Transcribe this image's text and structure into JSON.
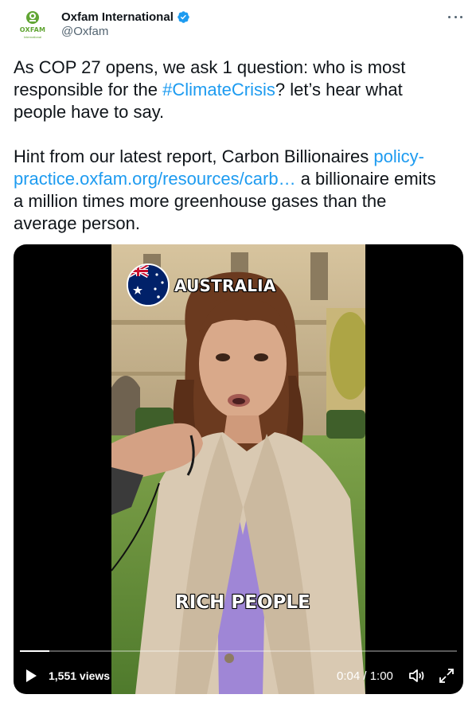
{
  "account": {
    "display_name": "Oxfam International",
    "handle": "@Oxfam",
    "avatar_wordmark": "OXFAM",
    "avatar_subtext": "International",
    "verified": true
  },
  "tweet": {
    "line1": "As COP 27 opens, we ask 1 question: who is most",
    "line2_before": "responsible for the ",
    "hashtag": "#ClimateCrisis",
    "line2_after": "?  let’s hear what",
    "line3": "people have to say.",
    "p2_before": "Hint from our latest report, Carbon Billionaires ",
    "p2_link_a": "policy-",
    "p2_link_b": "practice.oxfam.org/resources/carb…",
    "p2_after_link": " a billionaire emits",
    "p2_line3": "a million times more greenhouse gases than the",
    "p2_line4": "average person."
  },
  "video": {
    "caption_top": "AUSTRALIA",
    "caption_bottom": "RICH PEOPLE",
    "views": "1,551 views",
    "time": "0:04 / 1:00",
    "progress": 0.067
  },
  "colors": {
    "link": "#1d9bf0",
    "oxfam_green": "#61a534",
    "verified": "#1d9bf0"
  },
  "icons": [
    "verified-badge-icon",
    "more-icon",
    "play-icon",
    "volume-icon",
    "fullscreen-icon",
    "australia-flag-icon"
  ]
}
